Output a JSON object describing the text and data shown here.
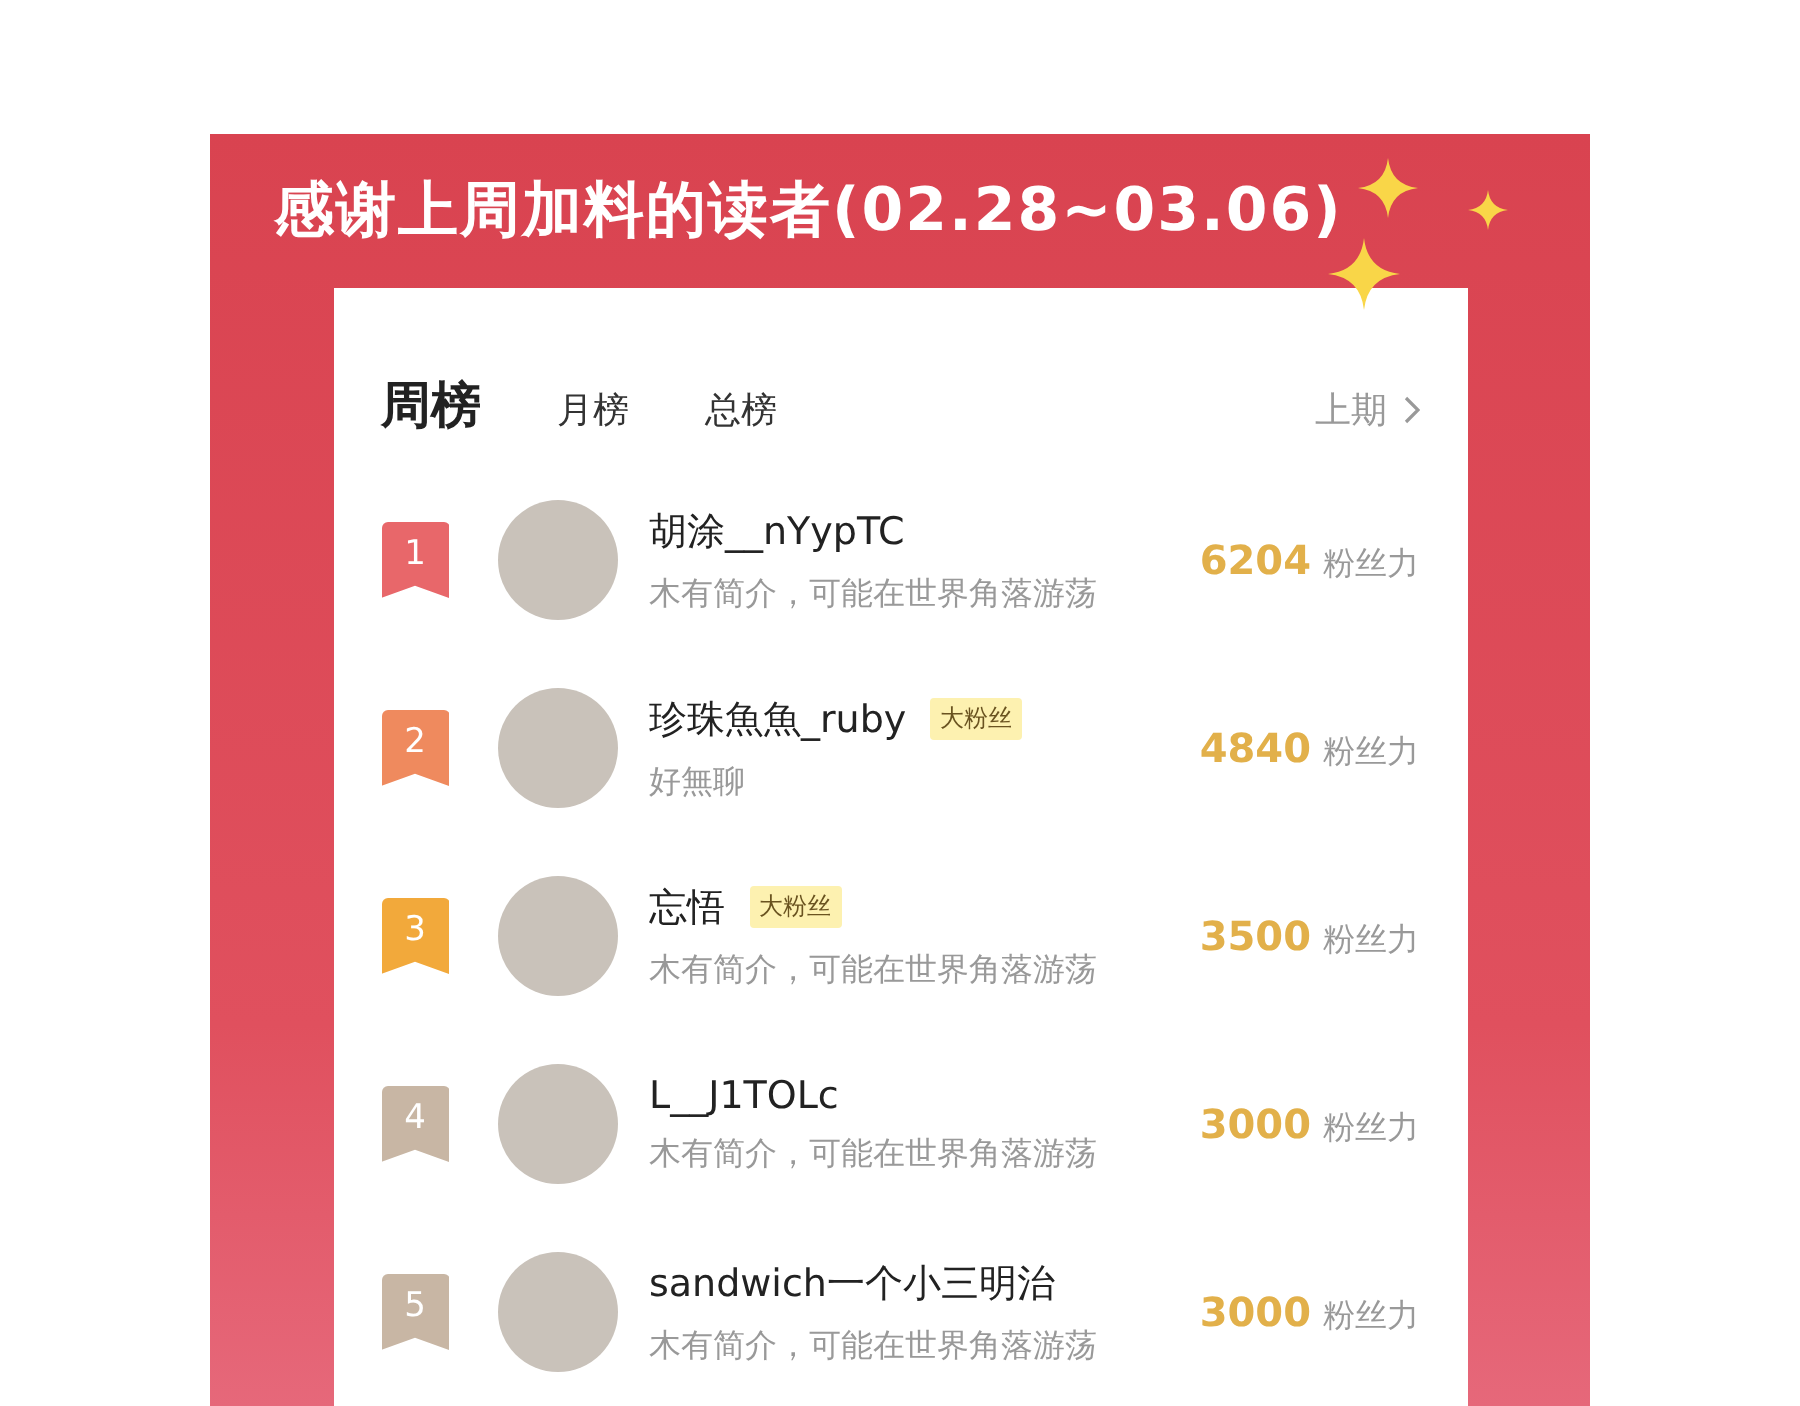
{
  "banner": {
    "title": "感谢上周加料的读者(02.28~03.06)"
  },
  "tabs": [
    {
      "label": "周榜",
      "selected": true
    },
    {
      "label": "月榜",
      "selected": false
    },
    {
      "label": "总榜",
      "selected": false
    }
  ],
  "previous_link": {
    "label": "上期"
  },
  "ranking": [
    {
      "rank": "1",
      "color": "#e8676a",
      "name": "胡涂__nYypTC",
      "bio": "木有简介，可能在世界角落游荡",
      "score": "6204",
      "score_unit": "粉丝力"
    },
    {
      "rank": "2",
      "color": "#ef8a5e",
      "name": "珍珠魚魚_ruby",
      "badge": "大粉丝",
      "bio": "好無聊",
      "score": "4840",
      "score_unit": "粉丝力"
    },
    {
      "rank": "3",
      "color": "#f2a93b",
      "name": "忘悟",
      "badge": "大粉丝",
      "bio": "木有简介，可能在世界角落游荡",
      "score": "3500",
      "score_unit": "粉丝力"
    },
    {
      "rank": "4",
      "color": "#c8b6a4",
      "name": "L__J1TOLc",
      "bio": "木有简介，可能在世界角落游荡",
      "score": "3000",
      "score_unit": "粉丝力"
    },
    {
      "rank": "5",
      "color": "#c8b6a4",
      "name": "sandwich一个小三明治",
      "bio": "木有简介，可能在世界角落游荡",
      "score": "3000",
      "score_unit": "粉丝力"
    }
  ]
}
